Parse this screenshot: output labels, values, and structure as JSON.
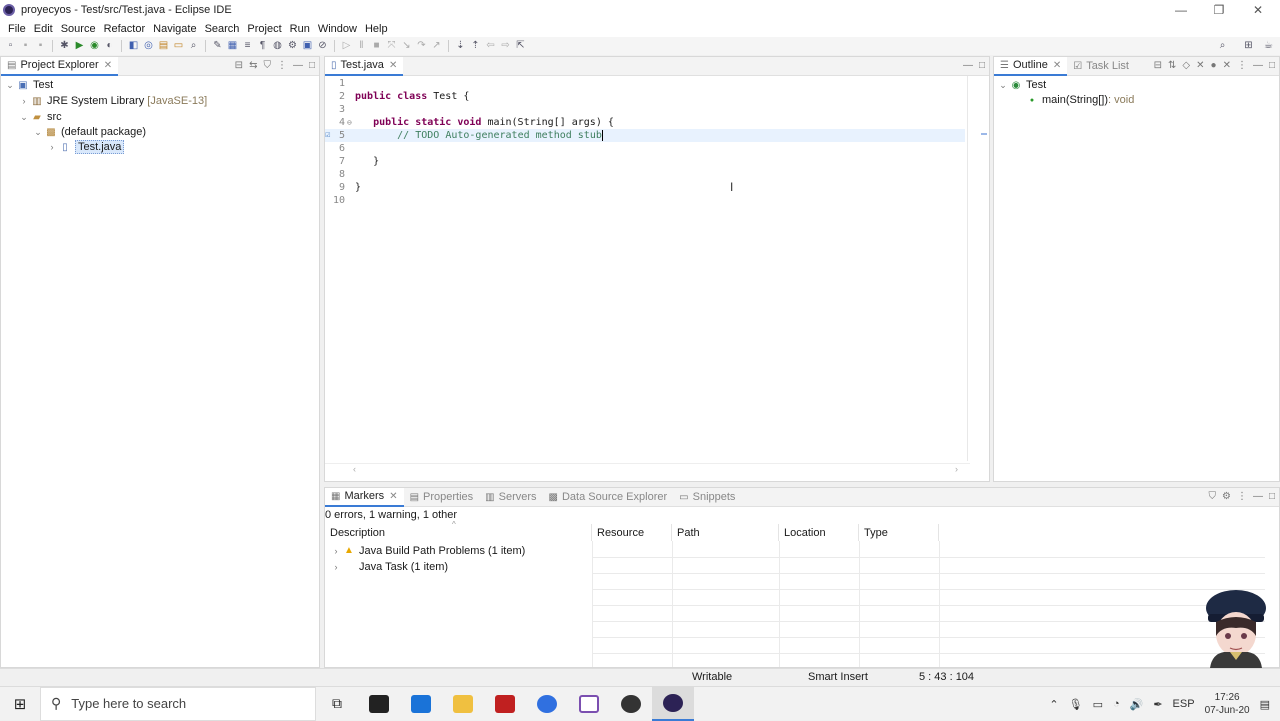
{
  "window": {
    "title": "proyecyos - Test/src/Test.java - Eclipse IDE",
    "minimize": "—",
    "restore": "❐",
    "close": "✕"
  },
  "menu": [
    "File",
    "Edit",
    "Source",
    "Refactor",
    "Navigate",
    "Search",
    "Project",
    "Run",
    "Window",
    "Help"
  ],
  "project_explorer": {
    "tab_label": "Project Explorer",
    "tree": {
      "project": "Test",
      "jre": "JRE System Library",
      "jre_version": "[JavaSE-13]",
      "src": "src",
      "package": "(default package)",
      "file": "Test.java"
    }
  },
  "editor": {
    "tab_label": "Test.java",
    "line_numbers": [
      "1",
      "2",
      "3",
      "4",
      "5",
      "6",
      "7",
      "8",
      "9",
      "10"
    ],
    "code": {
      "l2_kw": "public class",
      "l2_rest": " Test {",
      "l4_kw": "public static void",
      "l4_rest": " main(String[] args) {",
      "l5_comment": "// TODO Auto-generated method stub",
      "l7": "}",
      "l9": "}"
    }
  },
  "outline": {
    "tab_label": "Outline",
    "task_list_label": "Task List",
    "class_name": "Test",
    "method": "main(String[])",
    "method_type": " : void"
  },
  "bottom_panel": {
    "tabs": [
      "Markers",
      "Properties",
      "Servers",
      "Data Source Explorer",
      "Snippets"
    ],
    "summary": "0 errors, 1 warning, 1 other",
    "columns": [
      "Description",
      "Resource",
      "Path",
      "Location",
      "Type"
    ],
    "rows": [
      {
        "description": "Java Build Path Problems (1 item)",
        "icon": "warning-icon"
      },
      {
        "description": "Java Task (1 item)",
        "icon": "none"
      }
    ]
  },
  "status": {
    "writable": "Writable",
    "insert_mode": "Smart Insert",
    "position": "5 : 43 : 104"
  },
  "taskbar": {
    "search_placeholder": "Type here to search",
    "language": "ESP",
    "time": "17:26",
    "date": "07-Jun-20"
  },
  "colors": {
    "keyword": "#7f0055",
    "comment": "#3f7f5f",
    "active_tab": "#3a7bd5",
    "warning": "#e8a800"
  }
}
